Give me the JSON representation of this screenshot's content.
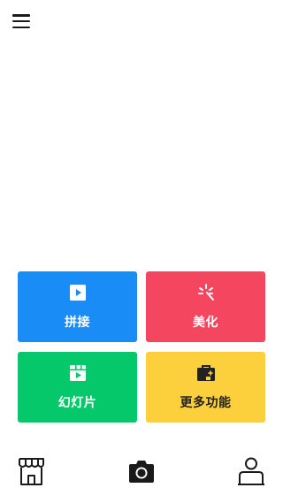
{
  "header": {
    "menu_icon": "hamburger-menu-icon"
  },
  "tiles": [
    {
      "label": "拼接",
      "icon": "play-square-icon",
      "color": "#1a8cf5",
      "text_color": "#ffffff"
    },
    {
      "label": "美化",
      "icon": "sparkle-icon",
      "color": "#f4465f",
      "text_color": "#ffffff"
    },
    {
      "label": "幻灯片",
      "icon": "slideshow-icon",
      "color": "#05c86a",
      "text_color": "#ffffff"
    },
    {
      "label": "更多功能",
      "icon": "toolbox-icon",
      "color": "#fcd03d",
      "text_color": "#222222"
    }
  ],
  "bottom_nav": {
    "store_icon": "store-icon",
    "camera_icon": "camera-icon",
    "profile_icon": "profile-icon"
  }
}
